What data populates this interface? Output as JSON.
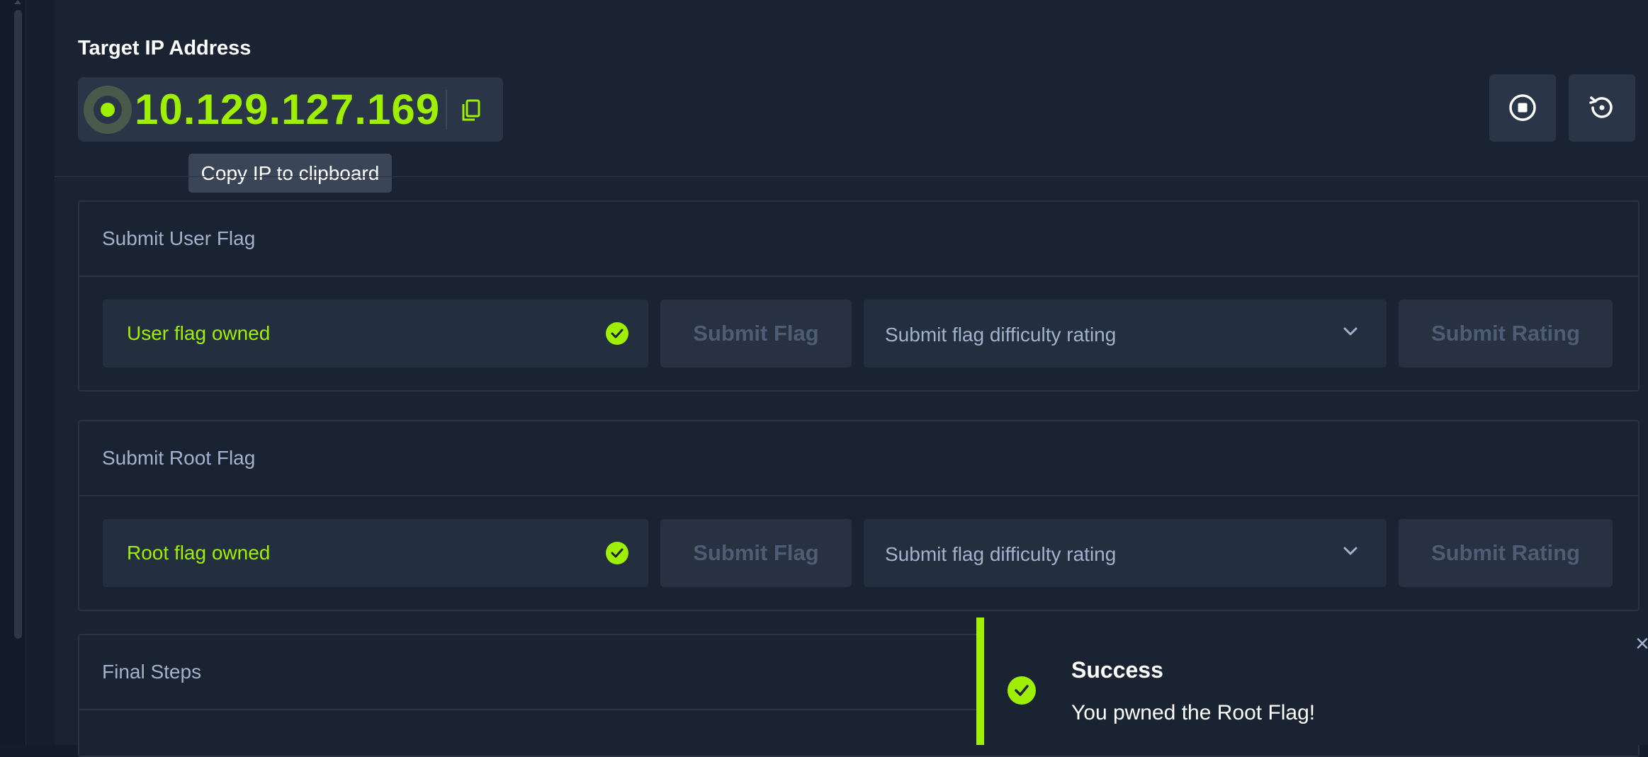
{
  "target": {
    "title": "Target IP Address",
    "ip": "10.129.127.169",
    "copy_tooltip": "Copy IP to clipboard"
  },
  "header_buttons": {
    "stop_icon": "stop-circle-icon",
    "reset_icon": "reset-icon"
  },
  "user_flag": {
    "heading": "Submit User Flag",
    "field_text": "User flag owned",
    "submit_label": "Submit Flag",
    "rating_placeholder": "Submit flag difficulty rating",
    "rating_submit_label": "Submit Rating"
  },
  "root_flag": {
    "heading": "Submit Root Flag",
    "field_text": "Root flag owned",
    "submit_label": "Submit Flag",
    "rating_placeholder": "Submit flag difficulty rating",
    "rating_submit_label": "Submit Rating"
  },
  "final_steps": {
    "heading": "Final Steps"
  },
  "toast": {
    "title": "Success",
    "message": "You pwned the Root Flag!",
    "close_symbol": "×"
  },
  "colors": {
    "accent": "#9fef00",
    "background": "#1a2332",
    "panel_border": "#2a3445",
    "muted_text": "#a4b1cd"
  }
}
